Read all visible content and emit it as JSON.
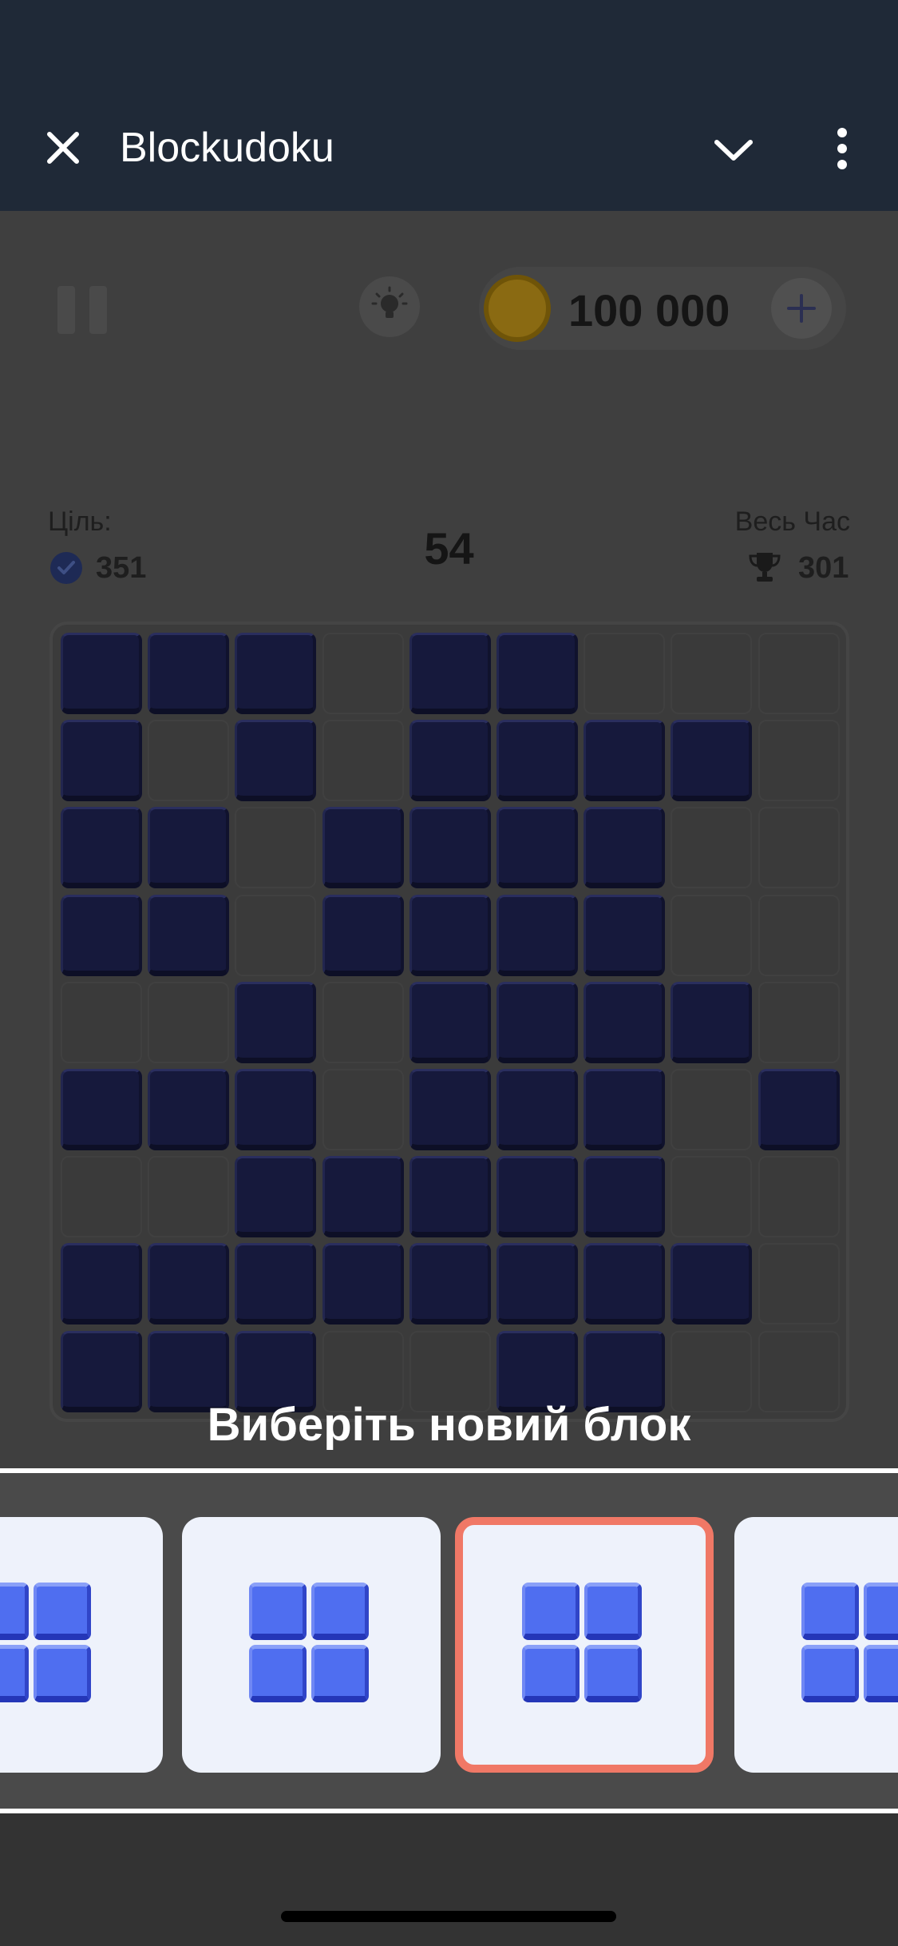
{
  "header": {
    "title": "Blockudoku",
    "close_icon": "close-icon",
    "collapse_icon": "chevron-down-icon",
    "menu_icon": "more-vertical-icon"
  },
  "toolbar": {
    "pause_icon": "pause-icon",
    "hint_icon": "lightbulb-icon",
    "coins": "100 000",
    "add_icon": "plus-icon"
  },
  "stats": {
    "goal_label": "Ціль:",
    "goal_value": "351",
    "score": "54",
    "best_label": "Весь Час",
    "best_value": "301"
  },
  "board": {
    "rows": [
      [
        1,
        1,
        1,
        0,
        1,
        1,
        0,
        0,
        0
      ],
      [
        1,
        0,
        1,
        0,
        1,
        1,
        1,
        1,
        0
      ],
      [
        1,
        1,
        0,
        1,
        1,
        1,
        1,
        0,
        0
      ],
      [
        1,
        1,
        0,
        1,
        1,
        1,
        1,
        0,
        0
      ],
      [
        0,
        0,
        1,
        0,
        1,
        1,
        1,
        1,
        0
      ],
      [
        1,
        1,
        1,
        0,
        1,
        1,
        1,
        0,
        1
      ],
      [
        0,
        0,
        1,
        1,
        1,
        1,
        1,
        0,
        0
      ],
      [
        1,
        1,
        1,
        1,
        1,
        1,
        1,
        1,
        0
      ],
      [
        1,
        1,
        1,
        0,
        0,
        1,
        1,
        0,
        0
      ]
    ]
  },
  "prompt": "Виберіть новий блок",
  "tray": {
    "cards": [
      "square-2x2",
      "square-2x2",
      "square-2x2",
      "square-2x2"
    ],
    "selected_index": 2
  },
  "colors": {
    "header_bg": "#1f2937",
    "filled_cell": "#16193c",
    "block": "#4f6ef0",
    "selected_border": "#f07866"
  }
}
